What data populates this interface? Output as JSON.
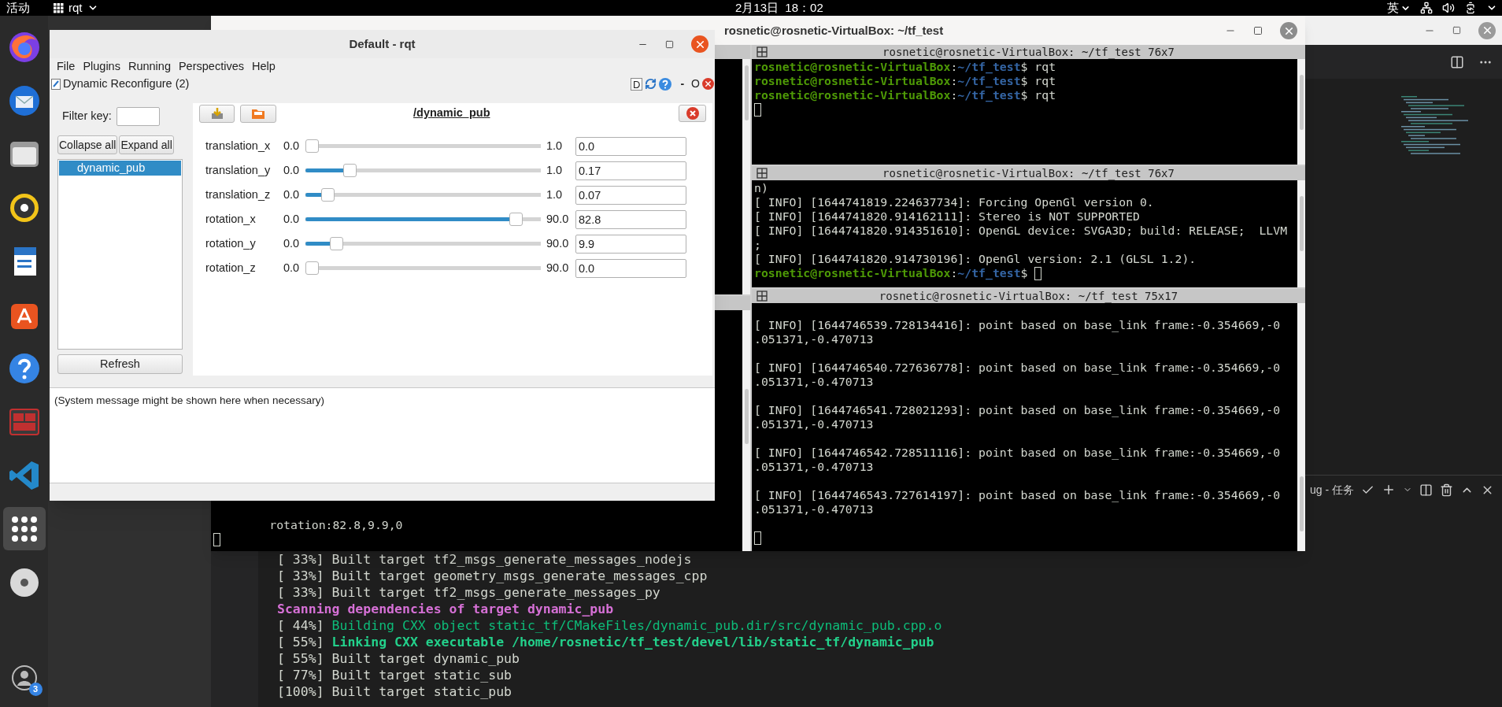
{
  "top_bar": {
    "activities": "活动",
    "app_menu": "rqt",
    "clock": "2月13日  18：02",
    "input_method": "英"
  },
  "dock": {
    "items": [
      {
        "kind": "browser",
        "selected": false
      },
      {
        "kind": "mail",
        "selected": false
      },
      {
        "kind": "files",
        "selected": false
      },
      {
        "kind": "music",
        "selected": false
      },
      {
        "kind": "writer",
        "selected": false
      },
      {
        "kind": "store",
        "selected": false
      },
      {
        "kind": "help",
        "selected": false
      },
      {
        "kind": "terminal",
        "selected": false
      },
      {
        "kind": "code",
        "selected": false
      },
      {
        "kind": "apps",
        "selected": true
      },
      {
        "kind": "disc",
        "selected": false
      }
    ],
    "account_badge": "3"
  },
  "vscode": {
    "panel_title": "ug - 任务",
    "output": [
      {
        "segments": [
          {
            "kind": "plain",
            "text": "[ 33%] Built target tf2_msgs_generate_messages_nodejs"
          }
        ]
      },
      {
        "segments": [
          {
            "kind": "plain",
            "text": "[ 33%] Built target geometry_msgs_generate_messages_cpp"
          }
        ]
      },
      {
        "segments": [
          {
            "kind": "plain",
            "text": "[ 33%] Built target tf2_msgs_generate_messages_py"
          }
        ]
      },
      {
        "segments": [
          {
            "kind": "magenta_bold",
            "text": "Scanning dependencies of target dynamic_pub"
          }
        ]
      },
      {
        "segments": [
          {
            "kind": "plain",
            "text": "[ 44%] "
          },
          {
            "kind": "green",
            "text": "Building CXX object static_tf/CMakeFiles/dynamic_pub.dir/src/dynamic_pub.cpp.o"
          }
        ]
      },
      {
        "segments": [
          {
            "kind": "plain",
            "text": "[ 55%] "
          },
          {
            "kind": "green_bold",
            "text": "Linking CXX executable /home/rosnetic/tf_test/devel/lib/static_tf/dynamic_pub"
          }
        ]
      },
      {
        "segments": [
          {
            "kind": "plain",
            "text": "[ 55%] Built target dynamic_pub"
          }
        ]
      },
      {
        "segments": [
          {
            "kind": "plain",
            "text": "[ 77%] Built target static_sub"
          }
        ]
      },
      {
        "segments": [
          {
            "kind": "plain",
            "text": "[100%] Built target static_pub"
          }
        ]
      }
    ]
  },
  "terminal": {
    "title": "rosnetic@rosnetic-VirtualBox: ~/tf_test",
    "left_pane": {
      "lines": [
        {
          "segments": [
            {
              "kind": "plain",
              "text": "        rotation:82.8,9.9,0"
            }
          ]
        },
        {
          "cursor": true
        }
      ]
    },
    "panes": [
      {
        "title": "rosnetic@rosnetic-VirtualBox: ~/tf_test 76x7",
        "lines": [
          {
            "segments": [
              {
                "kind": "user",
                "text": "rosnetic@rosnetic-VirtualBox"
              },
              {
                "kind": "plain",
                "text": ":"
              },
              {
                "kind": "path",
                "text": "~/tf_test"
              },
              {
                "kind": "plain",
                "text": "$ rqt"
              }
            ]
          },
          {
            "segments": [
              {
                "kind": "user",
                "text": "rosnetic@rosnetic-VirtualBox"
              },
              {
                "kind": "plain",
                "text": ":"
              },
              {
                "kind": "path",
                "text": "~/tf_test"
              },
              {
                "kind": "plain",
                "text": "$ rqt"
              }
            ]
          },
          {
            "segments": [
              {
                "kind": "user",
                "text": "rosnetic@rosnetic-VirtualBox"
              },
              {
                "kind": "plain",
                "text": ":"
              },
              {
                "kind": "path",
                "text": "~/tf_test"
              },
              {
                "kind": "plain",
                "text": "$ rqt"
              }
            ]
          },
          {
            "cursor": true
          }
        ]
      },
      {
        "title": "rosnetic@rosnetic-VirtualBox: ~/tf_test 76x7",
        "lines": [
          {
            "segments": [
              {
                "kind": "plain",
                "text": "n)"
              }
            ]
          },
          {
            "segments": [
              {
                "kind": "plain",
                "text": "[ INFO] [1644741819.224637734]: Forcing OpenGl version 0."
              }
            ]
          },
          {
            "segments": [
              {
                "kind": "plain",
                "text": "[ INFO] [1644741820.914162111]: Stereo is NOT SUPPORTED"
              }
            ]
          },
          {
            "segments": [
              {
                "kind": "plain",
                "text": "[ INFO] [1644741820.914351610]: OpenGL device: SVGA3D; build: RELEASE;  LLVM"
              }
            ]
          },
          {
            "segments": [
              {
                "kind": "plain",
                "text": ";"
              }
            ]
          },
          {
            "segments": [
              {
                "kind": "plain",
                "text": "[ INFO] [1644741820.914730196]: OpenGl version: 2.1 (GLSL 1.2)."
              }
            ]
          },
          {
            "segments": [
              {
                "kind": "user",
                "text": "rosnetic@rosnetic-VirtualBox"
              },
              {
                "kind": "plain",
                "text": ":"
              },
              {
                "kind": "path",
                "text": "~/tf_test"
              },
              {
                "kind": "plain",
                "text": "$ "
              }
            ],
            "cursor": true
          }
        ]
      },
      {
        "title": "rosnetic@rosnetic-VirtualBox: ~/tf_test 75x17",
        "lines": [
          {
            "blank_before": true,
            "segments": [
              {
                "kind": "plain",
                "text": "[ INFO] [1644746539.728134416]: point based on base_link frame:-0.354669,-0"
              }
            ]
          },
          {
            "segments": [
              {
                "kind": "plain",
                "text": ".051371,-0.470713"
              }
            ]
          },
          {
            "blank_before": true,
            "segments": [
              {
                "kind": "plain",
                "text": "[ INFO] [1644746540.727636778]: point based on base_link frame:-0.354669,-0"
              }
            ]
          },
          {
            "segments": [
              {
                "kind": "plain",
                "text": ".051371,-0.470713"
              }
            ]
          },
          {
            "blank_before": true,
            "segments": [
              {
                "kind": "plain",
                "text": "[ INFO] [1644746541.728021293]: point based on base_link frame:-0.354669,-0"
              }
            ]
          },
          {
            "segments": [
              {
                "kind": "plain",
                "text": ".051371,-0.470713"
              }
            ]
          },
          {
            "blank_before": true,
            "segments": [
              {
                "kind": "plain",
                "text": "[ INFO] [1644746542.728511116]: point based on base_link frame:-0.354669,-0"
              }
            ]
          },
          {
            "segments": [
              {
                "kind": "plain",
                "text": ".051371,-0.470713"
              }
            ]
          },
          {
            "blank_before": true,
            "segments": [
              {
                "kind": "plain",
                "text": "[ INFO] [1644746543.727614197]: point based on base_link frame:-0.354669,-0"
              }
            ]
          },
          {
            "segments": [
              {
                "kind": "plain",
                "text": ".051371,-0.470713"
              }
            ]
          },
          {
            "blank_before": true,
            "cursor": true
          }
        ]
      }
    ]
  },
  "rqt": {
    "title": "Default - rqt",
    "menu": [
      "File",
      "Plugins",
      "Running",
      "Perspectives",
      "Help"
    ],
    "plugin_title": "Dynamic Reconfigure (2)",
    "plugin_marks": {
      "d": "D",
      "minimize": "-",
      "float": "O"
    },
    "filter_label": "Filter key:",
    "collapse_button": "Collapse all",
    "expand_button": "Expand all",
    "tree": [
      {
        "label": "dynamic_pub",
        "selected": true
      }
    ],
    "refresh_button": "Refresh",
    "node_title": "/dynamic_pub",
    "params": [
      {
        "name": "translation_x",
        "min": "0.0",
        "max": "1.0",
        "value": "0.0",
        "level": 0
      },
      {
        "name": "translation_y",
        "min": "0.0",
        "max": "1.0",
        "value": "0.17",
        "level": 0.17
      },
      {
        "name": "translation_z",
        "min": "0.0",
        "max": "1.0",
        "value": "0.07",
        "level": 0.07
      },
      {
        "name": "rotation_x",
        "min": "0.0",
        "max": "90.0",
        "value": "82.8",
        "level": 0.92
      },
      {
        "name": "rotation_y",
        "min": "0.0",
        "max": "90.0",
        "value": "9.9",
        "level": 0.11
      },
      {
        "name": "rotation_z",
        "min": "0.0",
        "max": "90.0",
        "value": "0.0",
        "level": 0
      }
    ],
    "message": "(System message might be shown here when necessary)"
  }
}
